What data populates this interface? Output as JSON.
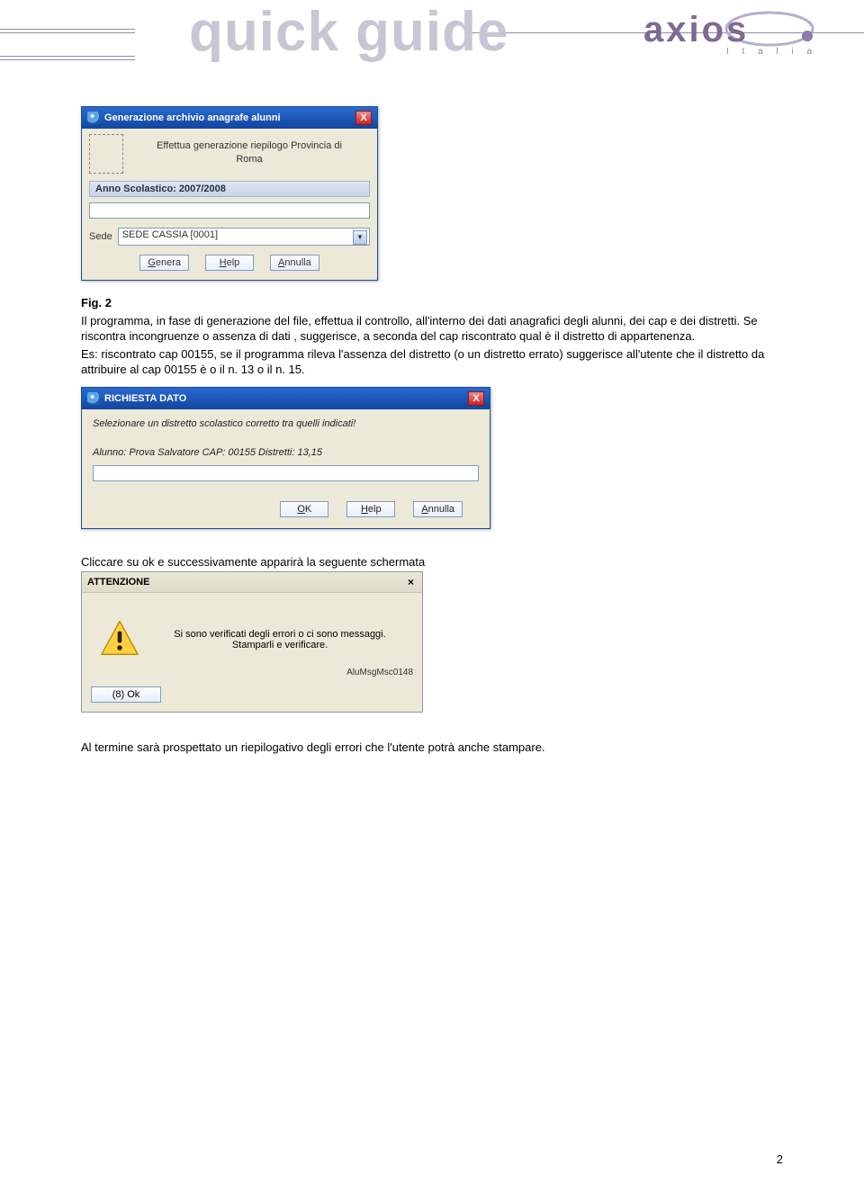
{
  "header": {
    "title": "quick guide",
    "logo_text": "axios",
    "logo_sub": "I t a l i a"
  },
  "dialog1": {
    "title": "Generazione archivio anagrafe alunni",
    "line1": "Effettua generazione riepilogo Provincia di",
    "line2": "Roma",
    "anno_label": "Anno Scolastico: 2007/2008",
    "sede_label": "Sede",
    "sede_value": "SEDE CASSIA [0001]",
    "btn_genera": "Genera",
    "btn_help": "Help",
    "btn_annulla": "Annulla"
  },
  "text": {
    "fig_label": "Fig. 2",
    "p1": "Il programma, in fase di generazione del file, effettua il controllo, all'interno dei dati anagrafici degli alunni, dei cap e dei distretti. Se riscontra incongruenze o assenza di dati , suggerisce, a seconda del cap riscontrato qual è il distretto di appartenenza.",
    "p2": "Es: riscontrato cap 00155, se il programma rileva l'assenza del distretto (o un distretto errato) suggerisce all'utente che il distretto da attribuire al cap 00155 è o il n. 13 o il n. 15.",
    "p3": "Cliccare su ok e successivamente apparirà la seguente schermata",
    "p4": "Al termine sarà prospettato  un riepilogativo degli errori che l'utente potrà anche stampare."
  },
  "dialog2": {
    "title": "RICHIESTA DATO",
    "msg": "Selezionare un distretto scolastico corretto tra quelli indicati!",
    "detail": "Alunno: Prova Salvatore  CAP: 00155  Distretti: 13,15",
    "btn_ok": "OK",
    "btn_help": "Help",
    "btn_annulla": "Annulla"
  },
  "dialog3": {
    "title": "ATTENZIONE",
    "msg1": "Si sono verificati degli errori o ci sono messaggi.",
    "msg2": "Stamparli e verificare.",
    "code": "AluMsgMsc0148",
    "btn_ok": "(8) Ok"
  },
  "page_number": "2"
}
